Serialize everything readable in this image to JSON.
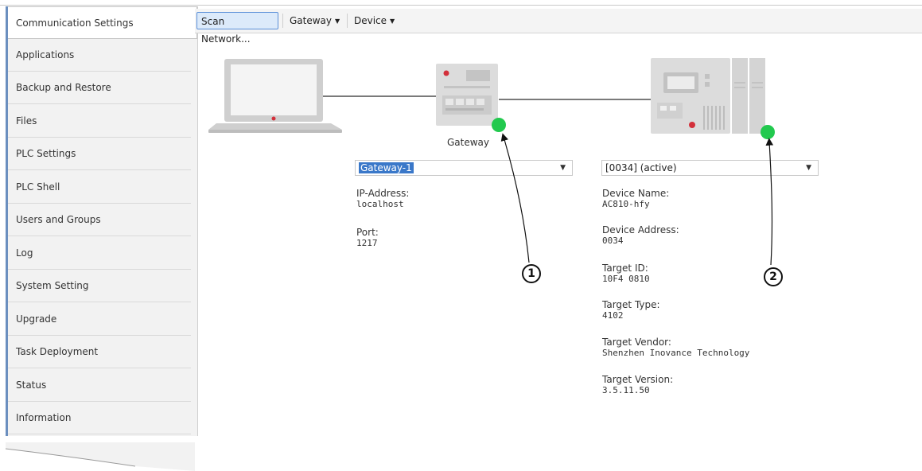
{
  "sidebar": {
    "items": [
      {
        "label": "Communication Settings"
      },
      {
        "label": "Applications"
      },
      {
        "label": "Backup and Restore"
      },
      {
        "label": "Files"
      },
      {
        "label": "PLC Settings"
      },
      {
        "label": "PLC Shell"
      },
      {
        "label": "Users and Groups"
      },
      {
        "label": "Log"
      },
      {
        "label": "System Setting"
      },
      {
        "label": "Upgrade"
      },
      {
        "label": "Task Deployment"
      },
      {
        "label": "Status"
      },
      {
        "label": "Information"
      }
    ]
  },
  "toolbar": {
    "scan_label": "Scan Network...",
    "gateway_label": "Gateway",
    "device_label": "Device"
  },
  "diagram": {
    "gateway_caption": "Gateway",
    "status_color": "#22c94e"
  },
  "gateway_panel": {
    "selected": "Gateway-1",
    "ip_label": "IP-Address:",
    "ip_value": "localhost",
    "port_label": "Port:",
    "port_value": "1217"
  },
  "device_panel": {
    "selected": "[0034] (active)",
    "fields": [
      {
        "label": "Device Name:",
        "value": "AC810-hfy"
      },
      {
        "label": "Device Address:",
        "value": "0034"
      },
      {
        "label": "Target ID:",
        "value": "10F4 0810"
      },
      {
        "label": "Target Type:",
        "value": "4102"
      },
      {
        "label": "Target Vendor:",
        "value": "Shenzhen Inovance Technology"
      },
      {
        "label": "Target Version:",
        "value": "3.5.11.50"
      }
    ]
  },
  "callouts": [
    "1",
    "2"
  ]
}
